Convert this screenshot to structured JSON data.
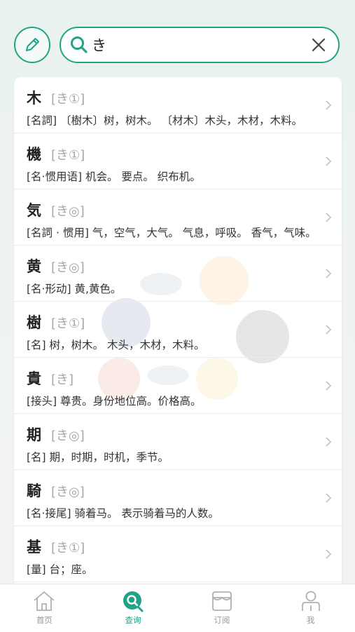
{
  "search": {
    "value": "き"
  },
  "results": [
    {
      "word": "木",
      "reading": "[き①]",
      "definition": "[名詞] 〔樹木〕树，树木。 〔材木〕木头，木材，木料。"
    },
    {
      "word": "機",
      "reading": "[き①]",
      "definition": "[名·惯用语] 机会。 要点。 织布机。"
    },
    {
      "word": "気",
      "reading": "[き◎]",
      "definition": "[名詞 · 惯用] 气，空气，大气。 气息，呼吸。 香气，气味。"
    },
    {
      "word": "黄",
      "reading": "[き◎]",
      "definition": "[名·形动] 黄,黄色。"
    },
    {
      "word": "樹",
      "reading": "[き①]",
      "definition": "[名] 树，树木。 木头，木材，木料。"
    },
    {
      "word": "貴",
      "reading": "[き]",
      "definition": "[接头] 尊贵。身份地位高。价格高。"
    },
    {
      "word": "期",
      "reading": "[き◎]",
      "definition": "[名] 期，时期，时机，季节。"
    },
    {
      "word": "騎",
      "reading": "[き◎]",
      "definition": "[名·接尾] 骑着马。 表示骑着马的人数。"
    },
    {
      "word": "基",
      "reading": "[き①]",
      "definition": "[量] 台；座。"
    }
  ],
  "tabs": [
    {
      "label": "首页",
      "icon": "home-icon",
      "active": false
    },
    {
      "label": "查询",
      "icon": "search-tab-icon",
      "active": true
    },
    {
      "label": "订阅",
      "icon": "store-icon",
      "active": false
    },
    {
      "label": "我",
      "icon": "person-icon",
      "active": false
    }
  ],
  "colors": {
    "accent": "#20a487",
    "muted": "#a7a7a7"
  }
}
